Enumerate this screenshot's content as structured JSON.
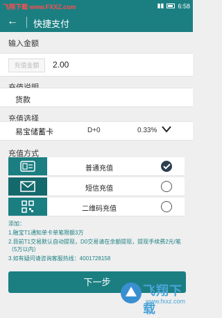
{
  "statusbar": {
    "watermark": "飞翔下载 www.FXXZ.com",
    "time": "6:58"
  },
  "header": {
    "back_glyph": "←",
    "title": "快捷支付"
  },
  "amount": {
    "label": "输入金额",
    "box_text": "充值金额",
    "value": "2.00"
  },
  "description": {
    "label": "充值说明",
    "value": "货款"
  },
  "selection": {
    "label": "充值选择",
    "card": "易宝储蓄卡",
    "mode": "D+0",
    "rate": "0.33%"
  },
  "methods": {
    "label": "充值方式",
    "items": [
      {
        "label": "普通充值",
        "icon": "card-icon",
        "selected": true
      },
      {
        "label": "短信充值",
        "icon": "envelope-icon",
        "selected": false
      },
      {
        "label": "二维码充值",
        "icon": "qr-code-icon",
        "selected": false
      }
    ]
  },
  "notes": [
    "添加：",
    "1.融宝T1通知单卡单笔限额3万",
    "2.目前T1交易默认自动提现，D0交易请在余额提现，提现手续费2元/笔（5万以内）",
    "3.如有疑问请咨询客服热线：4001728158"
  ],
  "next_button": "下一步",
  "watermark": {
    "big": "飞翔下载",
    "small": "www.fxxz.com"
  },
  "colors": {
    "primary": "#1b7f82",
    "selected": "#2c3e50"
  }
}
